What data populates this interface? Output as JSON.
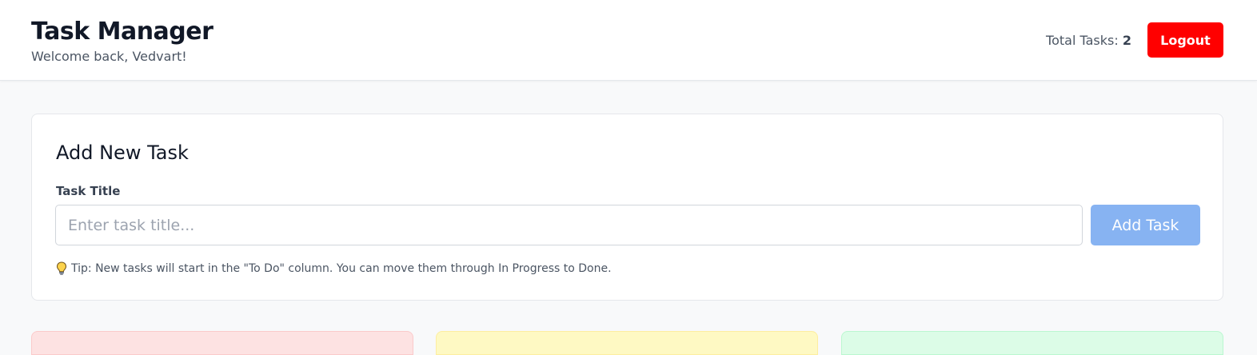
{
  "header": {
    "title": "Task Manager",
    "welcome": "Welcome back, Vedvart!",
    "total_tasks_label": "Total Tasks:",
    "total_tasks_count": "2",
    "logout_label": "Logout"
  },
  "add_task": {
    "title": "Add New Task",
    "field_label": "Task Title",
    "input_value": "",
    "input_placeholder": "Enter task title...",
    "button_label": "Add Task",
    "tip_icon": "lightbulb-icon",
    "tip_text": "Tip: New tasks will start in the \"To Do\" column. You can move them through In Progress to Done."
  },
  "colors": {
    "logout_bg": "#ff0000",
    "add_button_bg": "#87b3f2",
    "todo_column": "#fde2e2",
    "in_progress_column": "#fef9c3",
    "done_column": "#dcfce7"
  }
}
